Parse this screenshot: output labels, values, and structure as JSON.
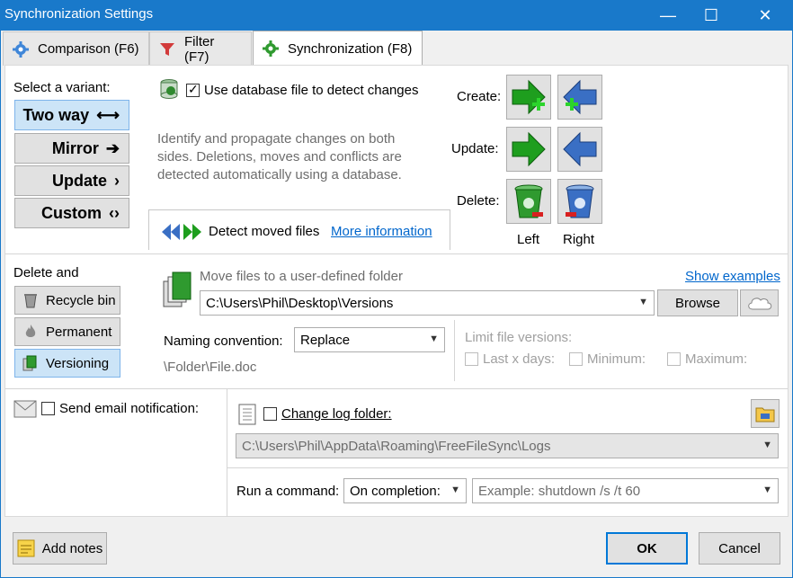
{
  "window": {
    "title": "Synchronization Settings",
    "minimize": "—",
    "maximize": "☐",
    "close": "✕"
  },
  "tabs": [
    {
      "label": "Comparison (F6)"
    },
    {
      "label": "Filter (F7)"
    },
    {
      "label": "Synchronization (F8)"
    }
  ],
  "variant": {
    "heading": "Select a variant:",
    "options": [
      {
        "label": "Two way",
        "arrow": "⟷",
        "selected": true
      },
      {
        "label": "Mirror",
        "arrow": "➔",
        "selected": false
      },
      {
        "label": "Update",
        "arrow": "›",
        "selected": false
      },
      {
        "label": "Custom",
        "arrow": "‹›",
        "selected": false
      }
    ]
  },
  "database": {
    "label": "Use database file to detect changes",
    "checked": true
  },
  "description": "Identify and propagate changes on both sides. Deletions, moves and conflicts are detected automatically using a database.",
  "moved": {
    "label": "Detect moved files",
    "link": "More information"
  },
  "actions": {
    "create": "Create:",
    "update": "Update:",
    "delete": "Delete:",
    "left": "Left",
    "right": "Right"
  },
  "deletion": {
    "heading": "Delete and",
    "options": [
      {
        "label": "Recycle bin",
        "selected": false
      },
      {
        "label": "Permanent",
        "selected": false
      },
      {
        "label": "Versioning",
        "selected": true
      }
    ]
  },
  "versioning": {
    "hint": "Move files to a user-defined folder",
    "show_examples": "Show examples",
    "path": "C:\\Users\\Phil\\Desktop\\Versions",
    "browse": "Browse",
    "naming_label": "Naming convention:",
    "naming_value": "Replace",
    "example": "\\Folder\\File.doc",
    "limit_label": "Limit file versions:",
    "last_days": "Last x days:",
    "minimum": "Minimum:",
    "maximum": "Maximum:"
  },
  "email": {
    "label": "Send email notification:",
    "checked": false
  },
  "log": {
    "label": "Change log folder:",
    "checked": false,
    "path": "C:\\Users\\Phil\\AppData\\Roaming\\FreeFileSync\\Logs"
  },
  "command": {
    "label": "Run a command:",
    "when": "On completion:",
    "placeholder": "Example: shutdown /s /t 60"
  },
  "footer": {
    "notes": "Add notes",
    "ok": "OK",
    "cancel": "Cancel"
  },
  "colors": {
    "titlebar": "#1979ca",
    "selected": "#cce4f7",
    "link": "#0066cc",
    "green_arrow": "#1e9e1e",
    "blue_arrow": "#3a6fc4"
  }
}
